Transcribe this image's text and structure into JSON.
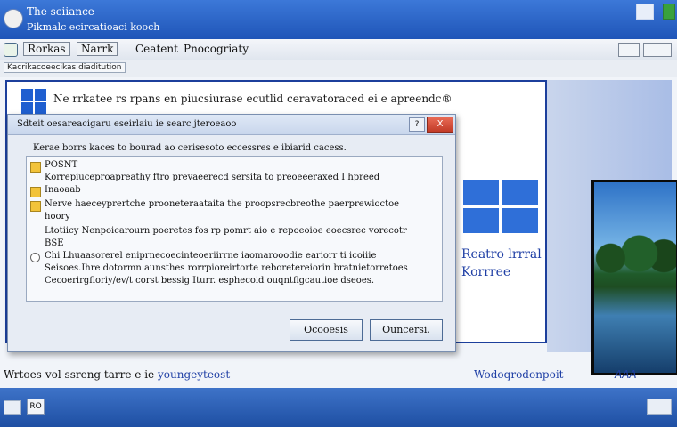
{
  "window": {
    "title_line1": "The sciiance",
    "title_line2": "Pikmalc ecircatioaci kooch"
  },
  "menu": {
    "items": [
      "Rorkas",
      "Narrk",
      "Ceatent",
      "Pnocogriaty"
    ]
  },
  "breadcrumb": "Kacrikacoeecikas diaditution",
  "banner": {
    "text": "Ne rrkatee rs rpans en piucsiurase ecutlid ceravatoraced ei e apreendc®"
  },
  "brand": {
    "line1": "Reatro lrrral",
    "line2": "Korrree"
  },
  "dialog": {
    "title": "Sdteit oesareacigaru eseirlaiu ie searc jteroeaoo",
    "heading": "Kerae borrs kaces to bourad ao cerisesoto eccessres e ibiarid cacess.",
    "help": "?",
    "close": "X",
    "rows": [
      {
        "label": "POSNT"
      },
      {
        "label": "Korrepiuceproapreathy ftro prevaeerecd sersita to preoeeeraxed I hpreed"
      },
      {
        "label": "Inaoaab"
      },
      {
        "label": "Nerve haeceyprertche prooneteraataita the proopsrecbreothe paerprewioctoe"
      },
      {
        "label": "hoory"
      },
      {
        "label": "Ltotiicy Nenpoicarourn poeretes fos rp pomrt aio e repoeoioe eoecsrec vorecotr"
      },
      {
        "label": "BSE"
      },
      {
        "label": "Chi Lhuaasorerel eniprnecoecinteoeriirrne iaomarooodie eariorr ti icoiiie"
      },
      {
        "label": "Seisoes.Ihre dotormn aunsthes rorrpioreirtorte reboretereiorin bratnietorretoes"
      },
      {
        "label": "Cecoerirgfioriy/ev/t corst bessig Iturr. esphecoid ouqntfigcautioe dseoes."
      }
    ],
    "buttons": {
      "primary": "Ocooesis",
      "secondary": "Ouncersi."
    }
  },
  "footer": {
    "left_text": "Wrtoes-vol ssreng tarre e ie",
    "left_link": "youngeyteost",
    "right_text": "Wodoqrodonpoit",
    "tag": "AAA"
  },
  "taskbar": {
    "item_label": "RO"
  }
}
